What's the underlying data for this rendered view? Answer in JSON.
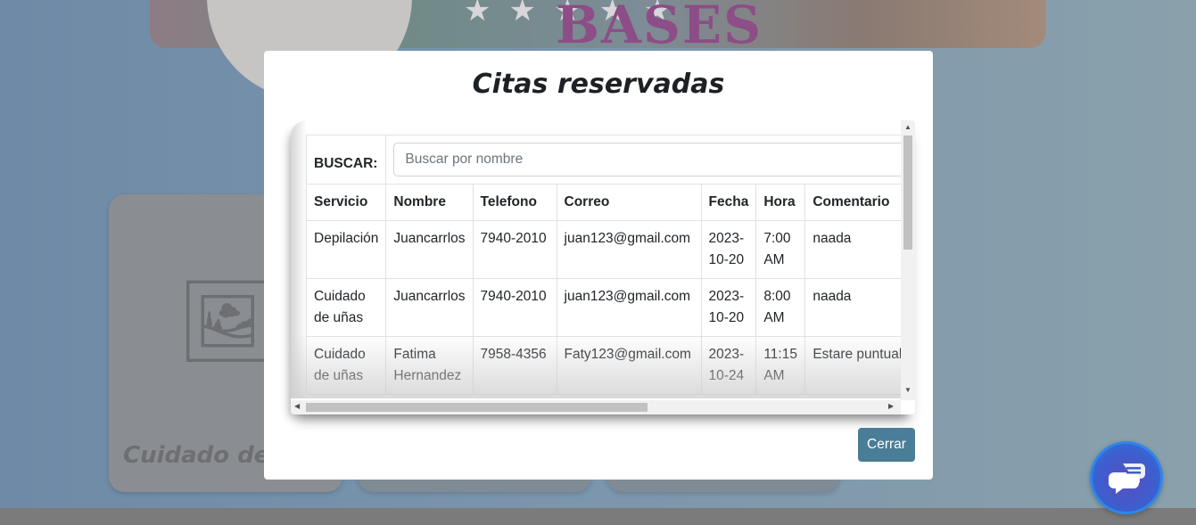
{
  "background": {
    "banner_brand": "BASES",
    "card_title": "Cuidado de u"
  },
  "modal": {
    "title": "Citas reservadas",
    "search_label": "BUSCAR:",
    "search_placeholder": "Buscar por nombre",
    "columns": [
      "Servicio",
      "Nombre",
      "Telefono",
      "Correo",
      "Fecha",
      "Hora",
      "Comentario"
    ],
    "rows": [
      [
        "Depilación",
        "Juancarrlos",
        "7940-2010",
        "juan123@gmail.com",
        "2023-10-20",
        "7:00 AM",
        "naada"
      ],
      [
        "Cuidado de uñas",
        "Juancarrlos",
        "7940-2010",
        "juan123@gmail.com",
        "2023-10-20",
        "8:00 AM",
        "naada"
      ],
      [
        "Cuidado de uñas",
        "Fatima Hernandez",
        "7958-4356",
        "Faty123@gmail.com",
        "2023-10-24",
        "11:15 AM",
        "Estare puntual"
      ]
    ],
    "close_label": "Cerrar"
  },
  "icons": {
    "chat": "chat-bubbles-icon",
    "image_placeholder": "image-placeholder-icon"
  }
}
